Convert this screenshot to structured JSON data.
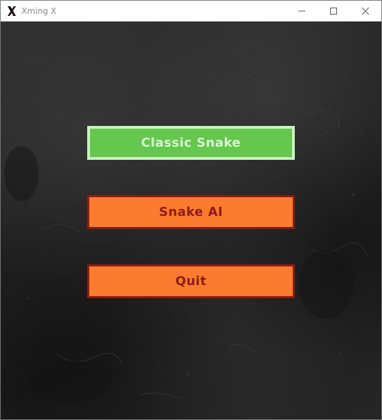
{
  "window": {
    "title": "Xming X",
    "icons": {
      "app": "xming-x-icon",
      "minimize": "minimize-icon",
      "maximize": "maximize-icon",
      "close": "close-icon"
    }
  },
  "menu": {
    "buttons": [
      {
        "label": "Classic Snake",
        "state": "selected",
        "color": "#66c74f"
      },
      {
        "label": "Snake AI",
        "state": "normal",
        "color": "#fb7b30"
      },
      {
        "label": "Quit",
        "state": "normal",
        "color": "#fb7b30"
      }
    ]
  },
  "colors": {
    "selected_bg": "#66c74f",
    "selected_border": "#c8f3c0",
    "normal_bg": "#fb7b30",
    "normal_border": "#8a1c12",
    "normal_text": "#8c1d14",
    "background": "#262626"
  }
}
